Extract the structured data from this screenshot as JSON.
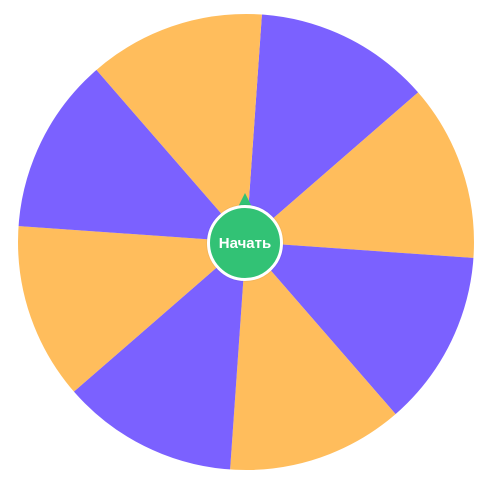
{
  "wheel": {
    "segment_colors": [
      "#7b61ff",
      "#ffbd5c",
      "#7b61ff",
      "#ffbd5c",
      "#7b61ff",
      "#ffbd5c",
      "#7b61ff",
      "#ffbd5c"
    ],
    "segment_count": 8,
    "start_angle_deg": -86
  },
  "start_button": {
    "label": "Начать",
    "color": "#32c275"
  }
}
